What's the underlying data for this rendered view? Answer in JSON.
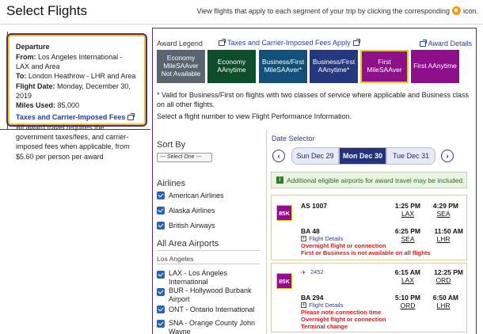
{
  "header": {
    "title": "Select Flights",
    "hint": "View flights that apply to each segment of your trip by clicking the corresponding",
    "hint_suffix": "icon."
  },
  "departure": {
    "heading": "Departure",
    "from_label": "From:",
    "from_value": "Los Angeles International - LAX and Area",
    "to_label": "To:",
    "to_value": "London Heathrow - LHR and Area",
    "date_label": "Flight Date:",
    "date_value": "Monday, December 30, 2019",
    "miles_label": "Miles Used:",
    "miles_value": "85,000",
    "taxes_link": "Taxes and Carrier-Imposed Fees",
    "note": "All award travel requires the government taxes/fees, and carrier-imposed fees when applicable, from $5.60 per person per award"
  },
  "legend": {
    "label": "Award Legend",
    "taxes_apply": "Taxes and Carrier-Imposed Fees Apply",
    "details": "Award Details",
    "items": [
      {
        "label": "Economy MileSAAver Not Available"
      },
      {
        "label": "Economy AAnytime"
      },
      {
        "label": "Business/First MileSAAver*"
      },
      {
        "label": "Business/First AAnytime*"
      },
      {
        "label": "First MileSAAver"
      },
      {
        "label": "First AAnytime"
      }
    ],
    "valid_note": "* Valid for Business/First on flights with two classes of service where applicable and Business class on all other flights.",
    "select_note": "Select a flight number to view Flight Performance Information."
  },
  "filters": {
    "sort_by": "Sort By",
    "sort_select": "--- Select One ---",
    "airlines_heading": "Airlines",
    "airlines": [
      "American Airlines",
      "Alaska Airlines",
      "British Airways"
    ],
    "airports_heading": "All Area Airports",
    "city": "Los Angeles",
    "airports": [
      "LAX - Los Angeles International",
      "BUR - Hollywood Burbank Airport",
      "ONT - Ontario International",
      "SNA - Orange County John Wayne"
    ]
  },
  "dates": {
    "label": "Date Selector",
    "prev": "Sun Dec 29",
    "current": "Mon Dec 30",
    "next": "Tue Dec 31"
  },
  "additional": "Additional eligible airports for award travel may be included.",
  "flights": [
    {
      "badge": "85K",
      "seg1": {
        "num": "AS 1007",
        "dep_time": "1:25 PM",
        "dep_ap": "LAX",
        "arr_time": "4:29 PM",
        "arr_ap": "SEA"
      },
      "seg2": {
        "num": "BA 48",
        "dep_time": "6:25 PM",
        "dep_ap": "SEA",
        "arr_time": "11:50 AM",
        "arr_ap": "LHR"
      },
      "details": "Flight Details",
      "warn1": "Overnight flight or connection",
      "warn2": "First or Business is not available on all flights"
    },
    {
      "badge": "85K",
      "codeshare": "2452",
      "seg1": {
        "num": "",
        "dep_time": "6:15 AM",
        "dep_ap": "LAX",
        "arr_time": "12:25 PM",
        "arr_ap": "ORD"
      },
      "seg2": {
        "num": "BA 294",
        "dep_time": "5:10 PM",
        "dep_ap": "ORD",
        "arr_time": "6:50 AM",
        "arr_ap": "LHR"
      },
      "details": "Flight Details",
      "warn1": "Please note connection time",
      "warn2": "Overnight flight or connection",
      "warn3": "Terminal change"
    }
  ]
}
